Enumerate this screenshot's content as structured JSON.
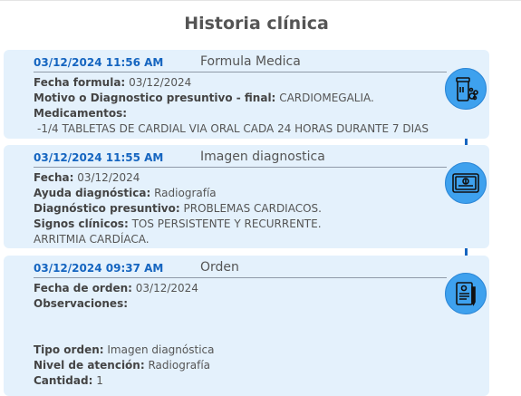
{
  "page": {
    "title": "Historia clínica"
  },
  "entries": [
    {
      "date": "03/12/2024 11:56 AM",
      "type": "Formula Medica",
      "icon": "prescription-bottle-icon",
      "fields": [
        {
          "label": "Fecha formula:",
          "value": "03/12/2024"
        },
        {
          "label": "Motivo o Diagnostico presuntivo - final:",
          "value": "CARDIOMEGALIA."
        },
        {
          "label": "Medicamentos:",
          "value": ""
        }
      ],
      "medication_line": "-1/4 TABLETAS DE CARDIAL VIA ORAL CADA 24 HORAS DURANTE 7 DIAS"
    },
    {
      "date": "03/12/2024 11:55 AM",
      "type": "Imagen diagnostica",
      "icon": "xray-image-icon",
      "fields": [
        {
          "label": "Fecha:",
          "value": "03/12/2024"
        },
        {
          "label": "Ayuda diagnóstica:",
          "value": "Radiografía"
        },
        {
          "label": "Diagnóstico presuntivo:",
          "value": "PROBLEMAS CARDIACOS."
        },
        {
          "label": "Signos clínicos:",
          "value": "TOS PERSISTENTE Y RECURRENTE."
        }
      ],
      "extra_line": "ARRITMIA CARDÍACA."
    },
    {
      "date": "03/12/2024 09:37 AM",
      "type": "Orden",
      "icon": "order-document-icon",
      "fields": [
        {
          "label": "Fecha de orden:",
          "value": "03/12/2024"
        },
        {
          "label": "Observaciones:",
          "value": ""
        },
        {
          "label": "Tipo orden:",
          "value": "Imagen diagnóstica"
        },
        {
          "label": "Nivel de atención:",
          "value": "Radiografía"
        },
        {
          "label": "Cantidad:",
          "value": "1"
        }
      ]
    }
  ],
  "colors": {
    "accent": "#1565c0",
    "card_bg": "#e4f1fc",
    "icon_circle": "#3ea1ee"
  }
}
